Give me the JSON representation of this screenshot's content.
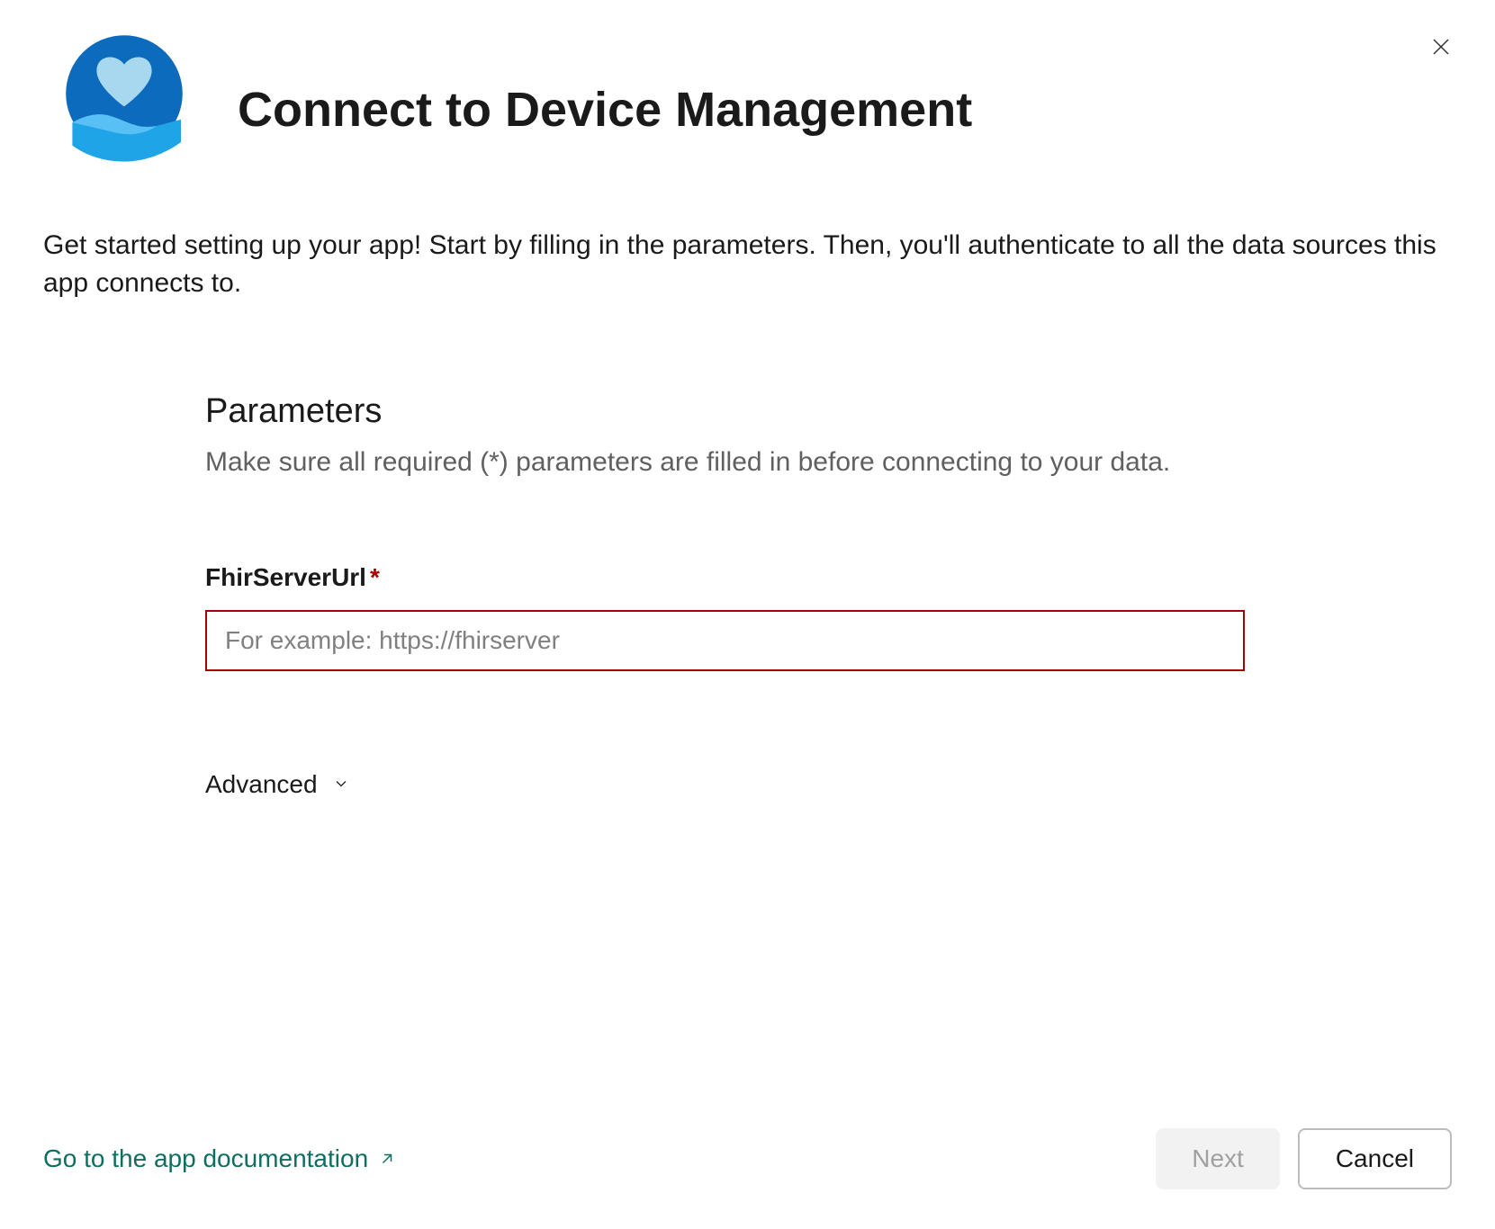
{
  "header": {
    "title": "Connect to Device Management"
  },
  "intro": "Get started setting up your app! Start by filling in the parameters. Then, you'll authenticate to all the data sources this app connects to.",
  "parameters": {
    "section_title": "Parameters",
    "section_subtitle": "Make sure all required (*) parameters are filled in before connecting to your data.",
    "fields": [
      {
        "label": "FhirServerUrl",
        "required": true,
        "placeholder": "For example: https://fhirserver",
        "value": ""
      }
    ],
    "advanced_label": "Advanced"
  },
  "footer": {
    "doc_link_label": "Go to the app documentation",
    "next_label": "Next",
    "cancel_label": "Cancel"
  }
}
